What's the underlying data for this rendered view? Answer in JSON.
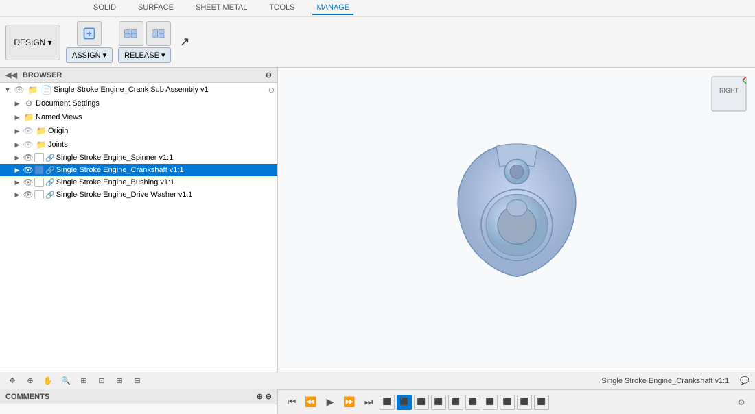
{
  "tabs": [
    "SOLID",
    "SURFACE",
    "SHEET METAL",
    "TOOLS",
    "MANAGE"
  ],
  "active_tab": "MANAGE",
  "design_btn": "DESIGN ▾",
  "toolbar": {
    "assign_label": "ASSIGN ▾",
    "release_label": "RELEASE ▾"
  },
  "browser": {
    "title": "BROWSER",
    "root_item": "Single Stroke Engine_Crank Sub Assembly v1",
    "items": [
      {
        "label": "Document Settings",
        "indent": 1,
        "type": "settings"
      },
      {
        "label": "Named Views",
        "indent": 1,
        "type": "folder"
      },
      {
        "label": "Origin",
        "indent": 1,
        "type": "folder_ghost"
      },
      {
        "label": "Joints",
        "indent": 1,
        "type": "folder_ghost"
      },
      {
        "label": "Single Stroke Engine_Spinner v1:1",
        "indent": 1,
        "type": "component",
        "selected": false
      },
      {
        "label": "Single Stroke Engine_Crankshaft v1:1",
        "indent": 1,
        "type": "component",
        "selected": true
      },
      {
        "label": "Single Stroke Engine_Bushing v1:1",
        "indent": 1,
        "type": "component",
        "selected": false
      },
      {
        "label": "Single Stroke Engine_Drive Washer v1:1",
        "indent": 1,
        "type": "component",
        "selected": false
      }
    ]
  },
  "viewport": {
    "view_label": "RIGHT"
  },
  "statusbar": {
    "component_name": "Single Stroke Engine_Crankshaft v1:1"
  },
  "comments": {
    "title": "COMMENTS"
  },
  "timeline_icons": [
    "⬛",
    "⬛",
    "⬛",
    "⬛",
    "⬛",
    "⬛",
    "⬛",
    "⬛",
    "⬛",
    "⬛"
  ]
}
